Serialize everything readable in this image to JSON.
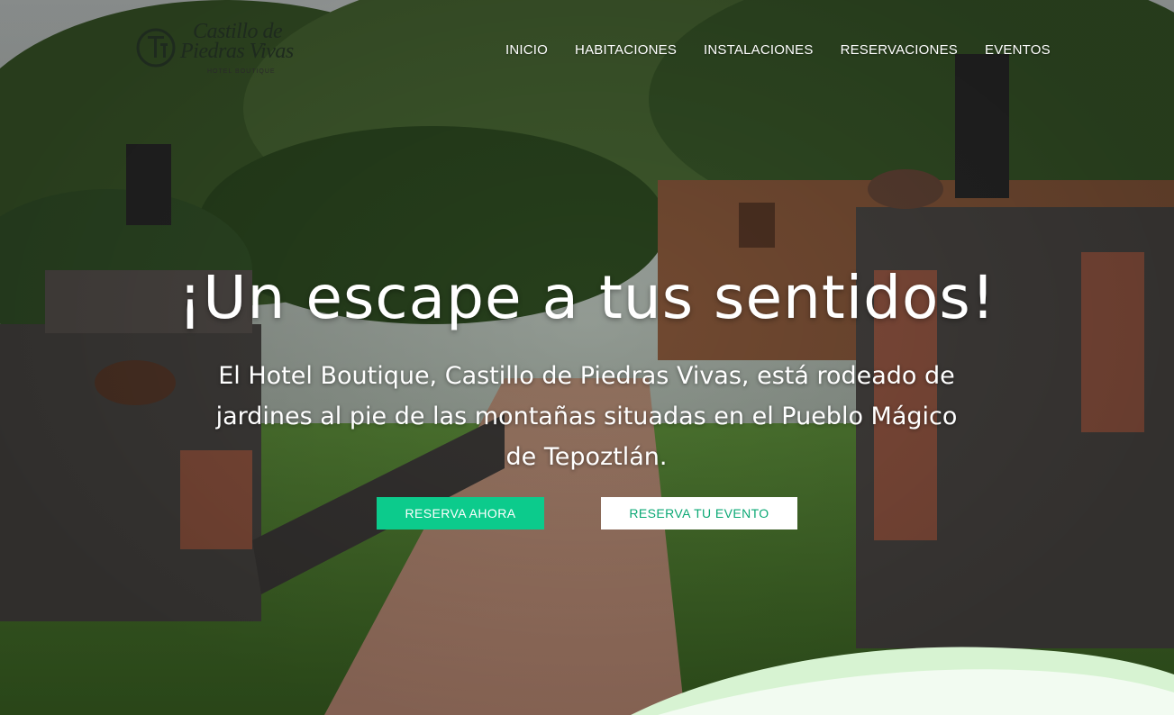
{
  "logo": {
    "line1": "Castillo de",
    "line2": "Piedras Vivas",
    "tagline": "HOTEL BOUTIQUE",
    "mark": "CPV"
  },
  "nav": {
    "items": [
      {
        "label": "INICIO"
      },
      {
        "label": "HABITACIONES"
      },
      {
        "label": "INSTALACIONES"
      },
      {
        "label": "RESERVACIONES"
      },
      {
        "label": "EVENTOS"
      }
    ]
  },
  "hero": {
    "title": "¡Un escape a tus sentidos!",
    "description": "El Hotel Boutique, Castillo de Piedras Vivas, está rodeado de jardines al pie de las montañas situadas en el Pueblo Mágico de Tepoztlán.",
    "primary_button": "RESERVA AHORA",
    "secondary_button": "RESERVA TU EVENTO"
  },
  "colors": {
    "accent": "#0ccb8c",
    "nav_text": "#ffffff",
    "wave": "#f2fbf1"
  }
}
